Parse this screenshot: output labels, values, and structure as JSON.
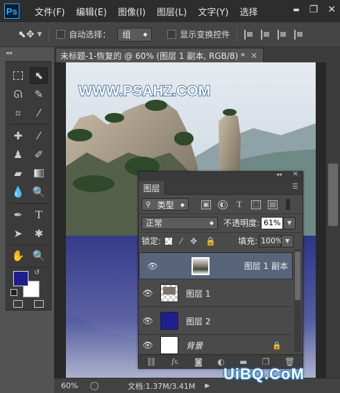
{
  "app": {
    "logo": "Ps"
  },
  "menu": {
    "items": [
      "文件(F)",
      "编辑(E)",
      "图像(I)",
      "图层(L)",
      "文字(Y)",
      "选择"
    ]
  },
  "window_controls": {
    "minimize": "▬",
    "restore": "❐",
    "close": "✕"
  },
  "options_bar": {
    "auto_select_label": "自动选择：",
    "auto_select_value": "组",
    "show_transform_label": "显示变换控件"
  },
  "document": {
    "tab_title": "未标题-1-恢复的 @ 60% (图层 1 副本, RGB/8) *",
    "tab_close": "×",
    "canvas_text": "WWW.PSAHZ.COM",
    "zoom": "60%",
    "doc_info": "文档:1.37M/3.41M"
  },
  "layers_panel": {
    "tab": "图层",
    "filter_type": "类型",
    "blend_mode": "正常",
    "opacity_label": "不透明度:",
    "opacity_value": "61%",
    "lock_label": "锁定:",
    "fill_label": "填充:",
    "fill_value": "100%",
    "layers": [
      {
        "name": "图层 1 副本",
        "selected": true,
        "thumb": "photo"
      },
      {
        "name": "图层 1",
        "selected": false,
        "thumb": "photo-transparent"
      },
      {
        "name": "图层 2",
        "selected": false,
        "thumb": "color",
        "color": "#1e2090"
      },
      {
        "name": "背景",
        "selected": false,
        "thumb": "white",
        "locked": true
      }
    ]
  },
  "watermark": "UiBQ.CoM",
  "colors": {
    "foreground": "#1c1f8c",
    "background": "#ffffff",
    "overlay_blue": "#232a94"
  }
}
